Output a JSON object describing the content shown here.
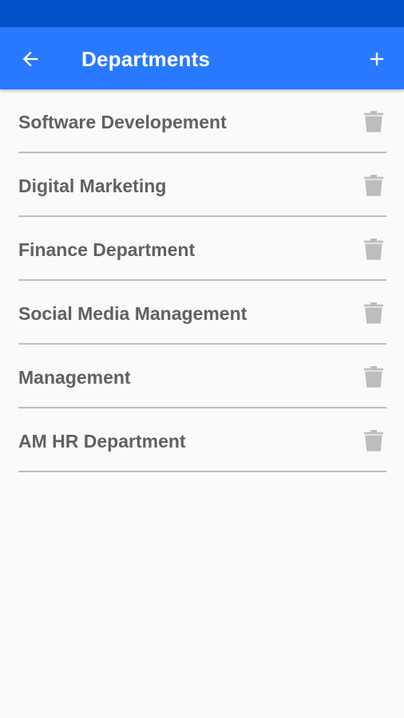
{
  "app_bar": {
    "title": "Departments",
    "back_icon": "arrow-back-icon",
    "add_icon": "plus-icon"
  },
  "colors": {
    "status_bar": "#0050c8",
    "app_bar": "#2979ff",
    "item_text": "#616161",
    "divider": "#bdbdbd",
    "delete_icon": "#bdbdbd"
  },
  "departments": [
    {
      "label": "Software Developement",
      "action_icon": "trash-icon"
    },
    {
      "label": "Digital Marketing",
      "action_icon": "trash-icon"
    },
    {
      "label": "Finance Department",
      "action_icon": "trash-icon"
    },
    {
      "label": "Social Media Management",
      "action_icon": "trash-icon"
    },
    {
      "label": "Management",
      "action_icon": "trash-icon"
    },
    {
      "label": "AM HR Department",
      "action_icon": "trash-icon"
    }
  ]
}
